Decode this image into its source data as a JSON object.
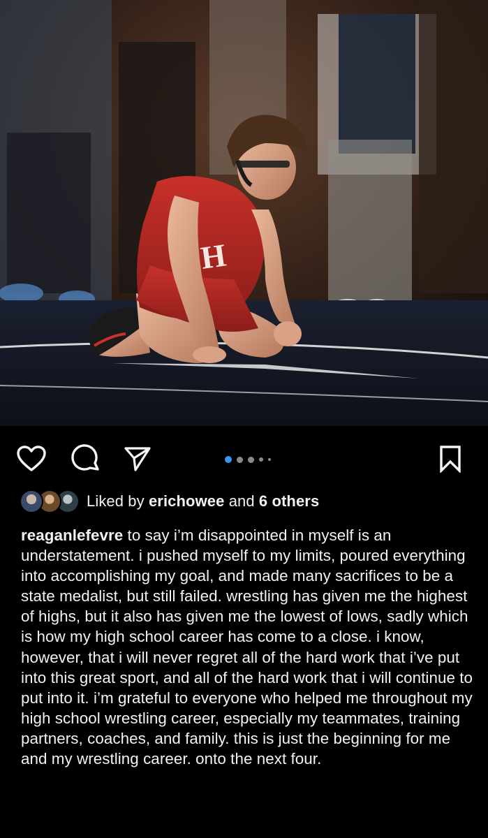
{
  "post": {
    "photo_alt": "",
    "carousel": {
      "total": 5,
      "active": 1
    }
  },
  "actions": {
    "like_icon": "heart-icon",
    "comment_icon": "comment-icon",
    "share_icon": "paper-plane-icon",
    "save_icon": "bookmark-icon"
  },
  "liked": {
    "prefix": "Liked by ",
    "user": "erichowee",
    "middle": " and ",
    "others": "6 others"
  },
  "caption": {
    "username": "reaganlefevre",
    "text": " to say i’m disappointed in myself is an understatement. i pushed myself to my limits, poured everything into accomplishing my goal, and made many sacrifices to be a state medalist, but still failed. wrestling has given me the highest of highs, but it also has given me the lowest of lows, sadly which is how my high school career has come to a close. i know, however, that i will never regret all of the hard work that i’ve put into this great sport, and all of the hard work that i will continue to put into it. i’m grateful to everyone who helped me throughout my high school wrestling career, especially my teammates, training partners, coaches, and family. this is just the beginning for me and my wrestling career. onto the next four."
  },
  "colors": {
    "background": "#000000",
    "text": "#f2f2f2",
    "active_dot": "#3897f0",
    "inactive_dot": "#8a8a8a"
  }
}
